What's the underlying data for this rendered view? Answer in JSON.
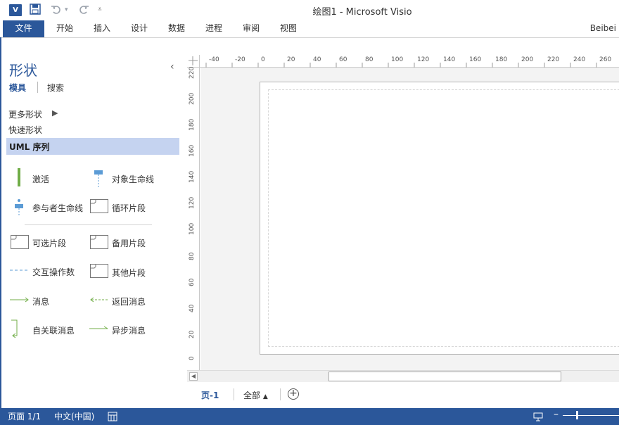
{
  "app": {
    "title": "绘图1 - Microsoft Visio",
    "logo": "V",
    "user": "Beibei"
  },
  "quick_access": {
    "icons": [
      "save-icon",
      "undo-icon",
      "redo-icon",
      "customize-icon"
    ]
  },
  "ribbon": {
    "tabs": [
      "文件",
      "开始",
      "插入",
      "设计",
      "数据",
      "进程",
      "审阅",
      "视图"
    ]
  },
  "shapes_pane": {
    "title": "形状",
    "tabs": [
      "模具",
      "搜索"
    ],
    "more_shapes": "更多形状",
    "quick_shapes": "快速形状",
    "active_stencil": "UML 序列",
    "shapes": [
      {
        "label": "激活",
        "icon": "activation-icon"
      },
      {
        "label": "对象生命线",
        "icon": "object-lifeline-icon"
      },
      {
        "label": "参与者生命线",
        "icon": "actor-lifeline-icon"
      },
      {
        "label": "循环片段",
        "icon": "loop-fragment-icon"
      },
      {
        "label": "可选片段",
        "icon": "optional-fragment-icon"
      },
      {
        "label": "备用片段",
        "icon": "alternative-fragment-icon"
      },
      {
        "label": "交互操作数",
        "icon": "interaction-operand-icon"
      },
      {
        "label": "其他片段",
        "icon": "other-fragment-icon"
      },
      {
        "label": "消息",
        "icon": "message-arrow-icon"
      },
      {
        "label": "返回消息",
        "icon": "return-message-icon"
      },
      {
        "label": "自关联消息",
        "icon": "self-message-icon"
      },
      {
        "label": "异步消息",
        "icon": "async-message-icon"
      }
    ]
  },
  "ruler": {
    "horizontal": [
      "-40",
      "-20",
      "0",
      "20",
      "40",
      "60",
      "80",
      "100",
      "120",
      "140",
      "160",
      "180",
      "200",
      "220",
      "240",
      "260"
    ],
    "vertical": [
      "220",
      "200",
      "180",
      "160",
      "140",
      "120",
      "100",
      "80",
      "60",
      "40",
      "20",
      "0"
    ]
  },
  "page_tabs": {
    "active": "页-1",
    "all": "全部",
    "all_arrow": "▲"
  },
  "status": {
    "page": "页面 1/1",
    "language": "中文(中国)"
  },
  "colors": {
    "accent": "#2b579a",
    "stencil_highlight": "#c5d3f0",
    "shape_green": "#70ad47",
    "shape_blue": "#5b9bd5"
  }
}
